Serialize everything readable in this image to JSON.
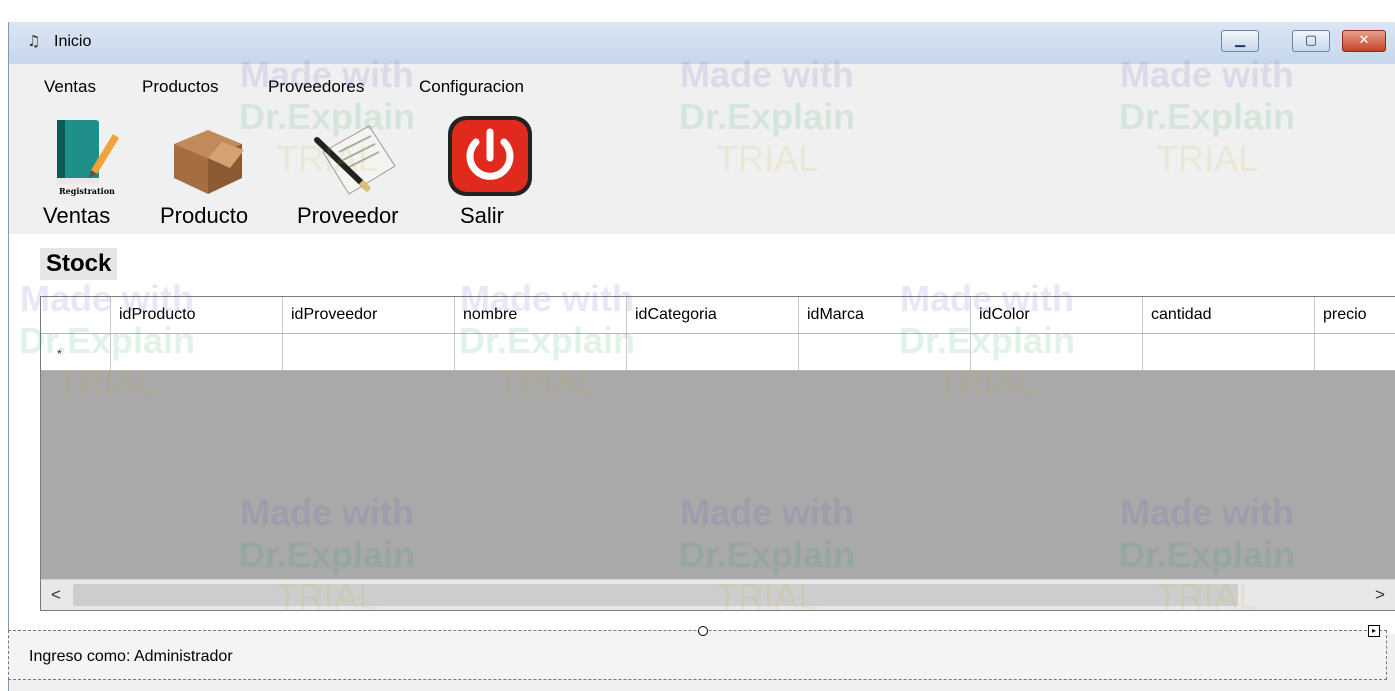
{
  "window": {
    "title": "Inicio",
    "app_icon": "app-note-icon",
    "controls": {
      "minimize": "minimize-icon",
      "maximize": "maximize-icon",
      "close": "close-icon"
    }
  },
  "menu": [
    "Ventas",
    "Productos",
    "Proveedores",
    "Configuracion"
  ],
  "toolbar": [
    {
      "label": "Ventas",
      "icon": "registration-book-icon",
      "caption": "Registration"
    },
    {
      "label": "Producto",
      "icon": "box-icon"
    },
    {
      "label": "Proveedor",
      "icon": "invoice-pen-icon"
    },
    {
      "label": "Salir",
      "icon": "power-icon"
    }
  ],
  "stock": {
    "title": "Stock",
    "columns": [
      "idProducto",
      "idProveedor",
      "nombre",
      "idCategoria",
      "idMarca",
      "idColor",
      "cantidad",
      "precio"
    ],
    "new_row_marker": "*"
  },
  "status": {
    "text": "Ingreso como: Administrador"
  },
  "watermark": {
    "line1": "Made with",
    "line2": "Dr.Explain",
    "line3": "TRIAL"
  },
  "colors": {
    "close_button": "#c5422a",
    "titlebar": "#c6d7ec",
    "grid_empty_area": "#a9a9a9"
  }
}
